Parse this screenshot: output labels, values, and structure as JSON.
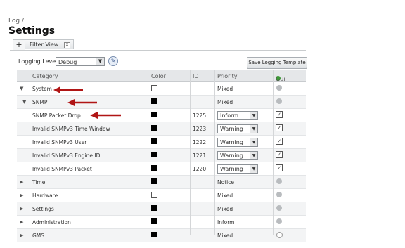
{
  "breadcrumb": "Log /",
  "title": "Settings",
  "tabs": {
    "add_label": "+",
    "filter_label": "Filter View",
    "close_label": "x"
  },
  "toolbar": {
    "logging_level_label": "Logging Level:",
    "logging_level_value": "Debug",
    "save_template_label": "Save Logging Template"
  },
  "columns": {
    "category": "Category",
    "color": "Color",
    "id": "ID",
    "priority": "Priority",
    "gui": "Gui"
  },
  "rows": [
    {
      "expander": "▼",
      "category": "System",
      "color": "empty",
      "id": "",
      "priority": "Mixed",
      "priority_select": false,
      "gui": "dot"
    },
    {
      "expander": "▼",
      "category": "SNMP",
      "color": "fill",
      "id": "",
      "priority": "Mixed",
      "priority_select": false,
      "gui": "dot"
    },
    {
      "expander": "",
      "category": "SNMP Packet Drop",
      "color": "fill",
      "id": "1225",
      "priority": "Inform",
      "priority_select": true,
      "gui": "check"
    },
    {
      "expander": "",
      "category": "Invalid SNMPv3 Time Window",
      "color": "fill",
      "id": "1223",
      "priority": "Warning",
      "priority_select": true,
      "gui": "check"
    },
    {
      "expander": "",
      "category": "Invalid SNMPv3 User",
      "color": "fill",
      "id": "1222",
      "priority": "Warning",
      "priority_select": true,
      "gui": "check"
    },
    {
      "expander": "",
      "category": "Invalid SNMPv3 Engine ID",
      "color": "fill",
      "id": "1221",
      "priority": "Warning",
      "priority_select": true,
      "gui": "check"
    },
    {
      "expander": "",
      "category": "Invalid SNMPv3 Packet",
      "color": "fill",
      "id": "1220",
      "priority": "Warning",
      "priority_select": true,
      "gui": "check"
    },
    {
      "expander": "▶",
      "category": "Time",
      "color": "fill",
      "id": "",
      "priority": "Notice",
      "priority_select": false,
      "gui": "dot"
    },
    {
      "expander": "▶",
      "category": "Hardware",
      "color": "empty",
      "id": "",
      "priority": "Mixed",
      "priority_select": false,
      "gui": "dot"
    },
    {
      "expander": "▶",
      "category": "Settings",
      "color": "fill",
      "id": "",
      "priority": "Mixed",
      "priority_select": false,
      "gui": "dot"
    },
    {
      "expander": "▶",
      "category": "Administration",
      "color": "fill",
      "id": "",
      "priority": "Inform",
      "priority_select": false,
      "gui": "dot"
    },
    {
      "expander": "▶",
      "category": "GMS",
      "color": "fill",
      "id": "",
      "priority": "Mixed",
      "priority_select": false,
      "gui": "white"
    }
  ],
  "colors": {
    "arrow": "#b01515",
    "gui_header_dot": "#3c9a35"
  }
}
